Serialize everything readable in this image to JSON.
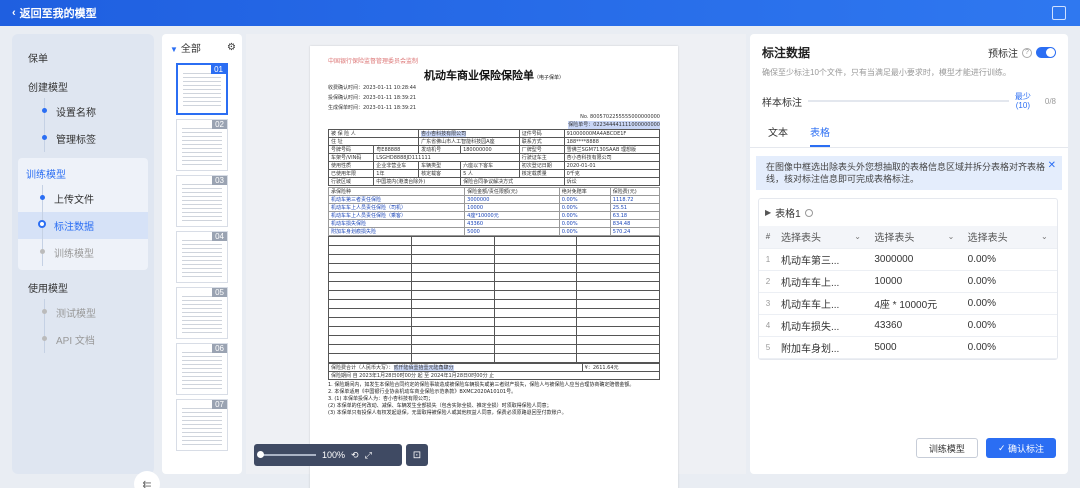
{
  "topbar": {
    "back_label": "返回至我的模型"
  },
  "nav": {
    "group1_title": "保单",
    "create_title": "创建模型",
    "create_items": [
      "设置名称",
      "管理标签"
    ],
    "train_title": "训练模型",
    "train_items": [
      "上传文件",
      "标注数据",
      "训练模型"
    ],
    "use_title": "使用模型",
    "use_items": [
      "测试模型",
      "API 文档"
    ]
  },
  "thumbs": {
    "all_label": "全部",
    "pages": [
      "01",
      "02",
      "03",
      "04",
      "05",
      "06",
      "07"
    ]
  },
  "doc": {
    "org": "中国银行保险监督管理委员会监制",
    "title": "机动车商业保险保险单",
    "title_small": "（电子保单）",
    "receipt_time": "收费确认时间：2023-01-11 10:28:44",
    "confirm_time": "投保确认时间：2023-01-11 18:39:21",
    "gen_time": "生成保单时间：2023-01-11 18:39:21",
    "no_line": "No. 8005702255555000000000",
    "policy_no": "保险单号：022344441111000000000",
    "insured": "杏小杏科技有限公司",
    "cert_label": "证件号码",
    "cert_no": "91000000MA4ABCDE1F",
    "addr_label": "住    址",
    "addr": "广东省佛山市人工智能科技园A座",
    "phone_label": "联系方式",
    "phone": "188****8888",
    "plate_label": "号牌号码",
    "plate": "粤E88888",
    "engine_label": "发动机号",
    "engine": "180000000",
    "model_label": "厂牌型号",
    "model": "雪佛兰SGM7130SAAB 理想版",
    "vin_label": "车架号/VIN码",
    "vin": "LSGHD8888JD111111",
    "owner_label": "行驶证车主",
    "owner": "杏小杏科技有限公司",
    "use_label": "使用性质",
    "use": "企业非营业车",
    "type_label": "车辆类型",
    "type": "六座以下客车",
    "reg_label": "初次登记日期",
    "reg": "2020-01-01",
    "mileage_label": "已使用年限",
    "mileage": "1年",
    "seats_label": "核定载客",
    "seats": "5    人",
    "load_label": "核定载质量",
    "load": "0千克",
    "area_label": "行驶区域",
    "area": "中国境内(港澳台除外)",
    "discount_label": "保险合同争议解决方式",
    "discount": "诉讼",
    "cov_head": [
      "承保险种",
      "保险金额/责任限额(元)",
      "绝对免赔率",
      "保险费(元)"
    ],
    "coverages": [
      [
        "机动车第三者责任保险",
        "3000000",
        "0.00%",
        "1118.72"
      ],
      [
        "机动车车上人员责任保险（司机）",
        "10000",
        "0.00%",
        "25.51"
      ],
      [
        "机动车车上人员责任保险（乘客）",
        "4座*10000元",
        "0.00%",
        "63.18"
      ],
      [
        "机动车损失保险",
        "43360",
        "0.00%",
        "834.48"
      ],
      [
        "附加车身划痕损失险",
        "5000",
        "0.00%",
        "570.24"
      ]
    ],
    "premium_label": "保险费合计（人民币大写）：",
    "premium": "贰仟陆佰壹拾壹元陆角肆分",
    "premium_num": "¥：2611.64元",
    "period": "保险期间  自 2023年1月28日0时00分 起  至 2024年1月28日0时00分 止",
    "notes": [
      "1. 保险期间内，如发生本保险合同约定的保险事故造成被保险车辆损失或第三者财产损失，保险人与被保险人应当合理协商确定赔偿金额。",
      "2. 本保单适用《中国银行业协会机动车商业保险示范条款》BXMC2020A10101号。",
      "3. (1) 本保单投保人为：杏小杏科技有限公司；",
      "(2) 本保单的任何改动、减保、车辆发生全部损失（包含实际全损、推定全损）时须取得保险人同意；",
      "(3) 本保单只有投保人有权发起退保，无需取得被保险人或其他权益人同意，保费必须原路退回至付款账户。"
    ]
  },
  "zoom": {
    "level": "100%"
  },
  "panel": {
    "title": "标注数据",
    "prelabel": "预标注",
    "hint": "确保至少标注10个文件，只有当满足最小要求时，模型才能进行训练。",
    "sample_label": "样本标注",
    "min_label": "最少",
    "min_num": "(10)",
    "count": "0/8",
    "tab_text": "文本",
    "tab_table": "表格",
    "notice": "在图像中框选出除表头外您想抽取的表格信息区域并拆分表格对齐表格线，核对标注信息即可完成表格标注。",
    "table_title": "表格1",
    "header_select": "选择表头",
    "rows": [
      [
        "1",
        "机动车第三...",
        "3000000",
        "0.00%"
      ],
      [
        "2",
        "机动车车上...",
        "10000",
        "0.00%"
      ],
      [
        "3",
        "机动车车上...",
        "4座 * 10000元",
        "0.00%"
      ],
      [
        "4",
        "机动车损失...",
        "43360",
        "0.00%"
      ],
      [
        "5",
        "附加车身划...",
        "5000",
        "0.00%"
      ]
    ],
    "btn_train": "训练模型",
    "btn_confirm": "确认标注"
  }
}
